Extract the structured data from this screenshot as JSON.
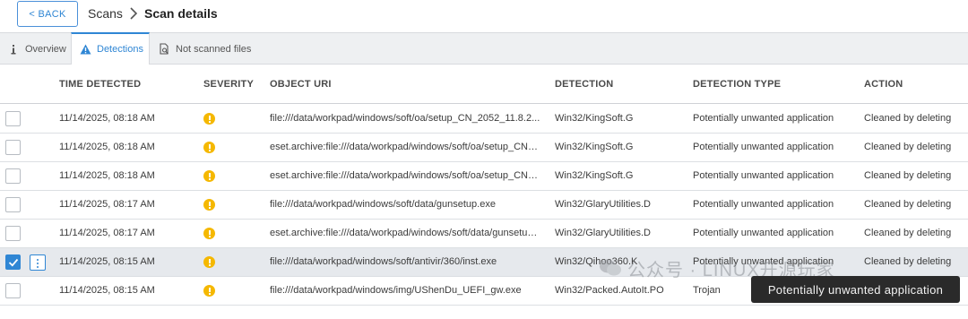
{
  "header": {
    "back_label": "< BACK",
    "crumbs": [
      "Scans",
      "Scan details"
    ]
  },
  "tabs": [
    {
      "label": "Overview",
      "icon": "info-icon"
    },
    {
      "label": "Detections",
      "icon": "warning-icon",
      "active": true
    },
    {
      "label": "Not scanned files",
      "icon": "file-search-icon"
    }
  ],
  "table": {
    "columns": [
      "TIME DETECTED",
      "SEVERITY",
      "OBJECT URI",
      "DETECTION",
      "DETECTION TYPE",
      "ACTION"
    ],
    "rows": [
      {
        "time": "11/14/2025, 08:18 AM",
        "severity": "warning",
        "uri": "file:///data/workpad/windows/soft/oa/setup_CN_2052_11.8.2...",
        "detection": "Win32/KingSoft.G",
        "type": "Potentially unwanted application",
        "action": "Cleaned by deleting",
        "checked": false
      },
      {
        "time": "11/14/2025, 08:18 AM",
        "severity": "warning",
        "uri": "eset.archive:file:///data/workpad/windows/soft/oa/setup_CN_...",
        "detection": "Win32/KingSoft.G",
        "type": "Potentially unwanted application",
        "action": "Cleaned by deleting",
        "checked": false
      },
      {
        "time": "11/14/2025, 08:18 AM",
        "severity": "warning",
        "uri": "eset.archive:file:///data/workpad/windows/soft/oa/setup_CN_...",
        "detection": "Win32/KingSoft.G",
        "type": "Potentially unwanted application",
        "action": "Cleaned by deleting",
        "checked": false
      },
      {
        "time": "11/14/2025, 08:17 AM",
        "severity": "warning",
        "uri": "file:///data/workpad/windows/soft/data/gunsetup.exe",
        "detection": "Win32/GlaryUtilities.D",
        "type": "Potentially unwanted application",
        "action": "Cleaned by deleting",
        "checked": false
      },
      {
        "time": "11/14/2025, 08:17 AM",
        "severity": "warning",
        "uri": "eset.archive:file:///data/workpad/windows/soft/data/gunsetup....",
        "detection": "Win32/GlaryUtilities.D",
        "type": "Potentially unwanted application",
        "action": "Cleaned by deleting",
        "checked": false
      },
      {
        "time": "11/14/2025, 08:15 AM",
        "severity": "warning",
        "uri": "file:///data/workpad/windows/soft/antivir/360/inst.exe",
        "detection": "Win32/Qihoo360.K",
        "type": "Potentially unwanted application",
        "action": "Cleaned by deleting",
        "checked": true
      },
      {
        "time": "11/14/2025, 08:15 AM",
        "severity": "warning",
        "uri": "file:///data/workpad/windows/img/UShenDu_UEFI_gw.exe",
        "detection": "Win32/Packed.AutoIt.PO",
        "type": "Trojan",
        "action": "",
        "checked": false
      }
    ]
  },
  "tooltip": "Potentially unwanted application",
  "watermark": "公众号 · LINUX开源玩家",
  "colors": {
    "accent": "#2f86d4",
    "severity_warning": "#f5b800",
    "selected_row": "#e6e9ed"
  }
}
